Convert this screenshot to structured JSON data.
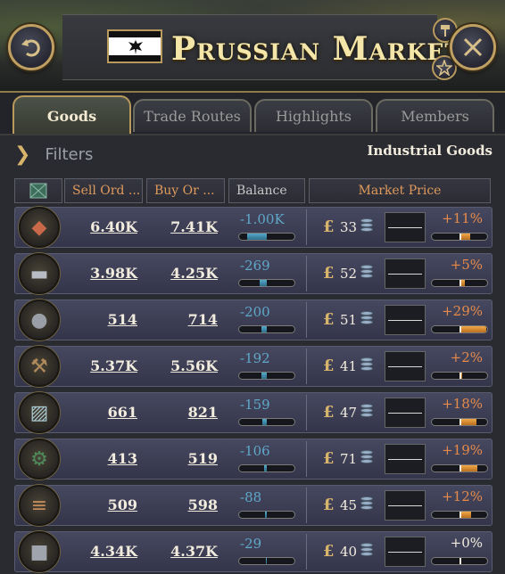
{
  "header": {
    "title": "Prussian Market",
    "flag": "prussia-flag",
    "buttons": {
      "back": "back-arrow-icon",
      "close": "close-x-icon",
      "pin": "pin-icon",
      "star": "star-icon"
    }
  },
  "tabs": [
    {
      "label": "Goods",
      "active": true
    },
    {
      "label": "Trade Routes",
      "active": false
    },
    {
      "label": "Highlights",
      "active": false
    },
    {
      "label": "Members",
      "active": false
    }
  ],
  "filters": {
    "label": "Filters",
    "category": "Industrial Goods"
  },
  "columns": {
    "sell": "Sell Ord ...",
    "buy": "Buy Or ...",
    "balance": "Balance",
    "price": "Market Price"
  },
  "colors": {
    "accent_orange": "#e09a5c",
    "balance_blue": "#5fa8c8",
    "gold": "#d7b46c"
  },
  "rows": [
    {
      "good_icon": "iron-icon",
      "sell": "6.40K",
      "buy": "7.41K",
      "balance": "-1.00K",
      "balance_level": 0.7,
      "currency": "£",
      "price": "33",
      "change": "+11%",
      "change_level": 0.11
    },
    {
      "good_icon": "steel-icon",
      "sell": "3.98K",
      "buy": "4.25K",
      "balance": "-269",
      "balance_level": 0.25,
      "currency": "£",
      "price": "52",
      "change": "+5%",
      "change_level": 0.05
    },
    {
      "good_icon": "ammunition-icon",
      "sell": "514",
      "buy": "714",
      "balance": "-200",
      "balance_level": 0.2,
      "currency": "£",
      "price": "51",
      "change": "+29%",
      "change_level": 0.29
    },
    {
      "good_icon": "tools-icon",
      "sell": "5.37K",
      "buy": "5.56K",
      "balance": "-192",
      "balance_level": 0.18,
      "currency": "£",
      "price": "41",
      "change": "+2%",
      "change_level": 0.02
    },
    {
      "good_icon": "glass-icon",
      "sell": "661",
      "buy": "821",
      "balance": "-159",
      "balance_level": 0.15,
      "currency": "£",
      "price": "47",
      "change": "+18%",
      "change_level": 0.18
    },
    {
      "good_icon": "engines-icon",
      "sell": "413",
      "buy": "519",
      "balance": "-106",
      "balance_level": 0.1,
      "currency": "£",
      "price": "71",
      "change": "+19%",
      "change_level": 0.19
    },
    {
      "good_icon": "hardwood-icon",
      "sell": "509",
      "buy": "598",
      "balance": "-88",
      "balance_level": 0.08,
      "currency": "£",
      "price": "45",
      "change": "+12%",
      "change_level": 0.12
    },
    {
      "good_icon": "lead-icon",
      "sell": "4.34K",
      "buy": "4.37K",
      "balance": "-29",
      "balance_level": 0.03,
      "currency": "£",
      "price": "40",
      "change": "+0%",
      "change_level": 0.0
    }
  ]
}
